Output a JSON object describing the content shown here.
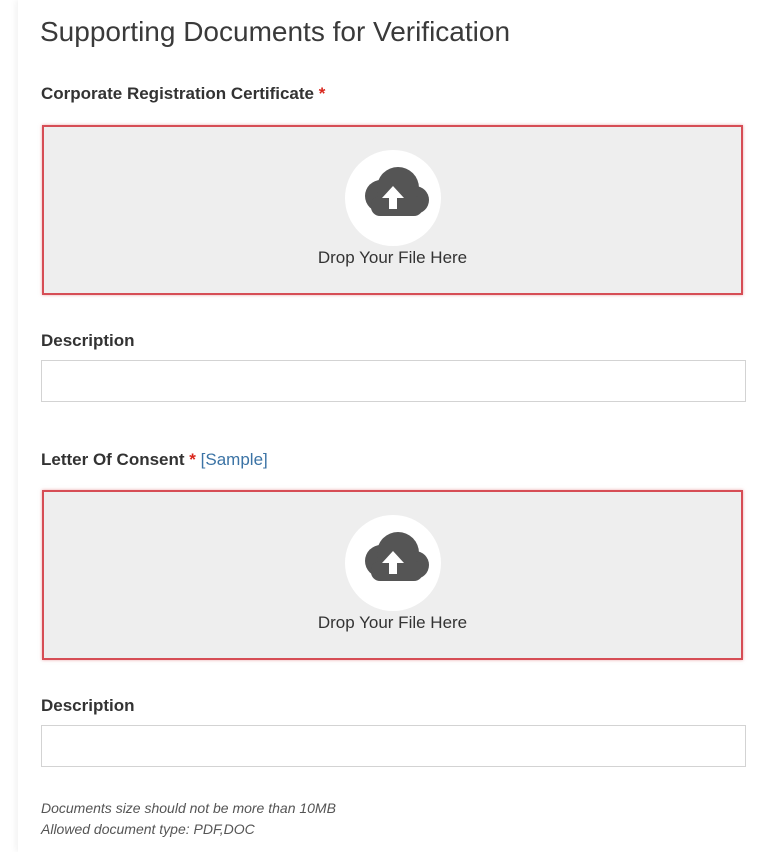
{
  "page": {
    "title": "Supporting Documents for Verification"
  },
  "colors": {
    "required": "#d9261c",
    "link": "#3b73a5",
    "dropzone_border": "#d64d55",
    "dropzone_bg": "#eeeeee",
    "icon": "#555555"
  },
  "fields": [
    {
      "label": "Corporate Registration Certificate",
      "required_mark": "*",
      "dropzone_text": "Drop Your File Here",
      "dropzone_icon": "cloud-upload-icon",
      "description_label": "Description",
      "description_value": ""
    },
    {
      "label": "Letter Of Consent",
      "required_mark": "*",
      "sample_link": "[Sample]",
      "dropzone_text": "Drop Your File Here",
      "dropzone_icon": "cloud-upload-icon",
      "description_label": "Description",
      "description_value": ""
    }
  ],
  "notes": {
    "size_limit": "Documents size should not be more than 10MB",
    "allowed_types": "Allowed document type: PDF,DOC"
  }
}
